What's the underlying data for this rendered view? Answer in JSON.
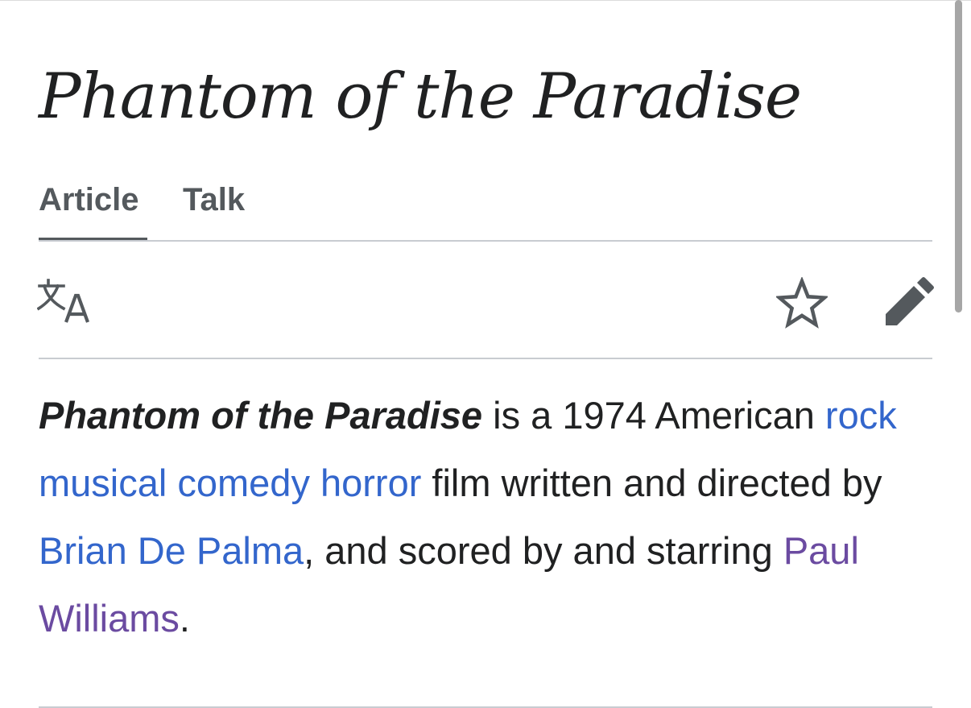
{
  "page": {
    "title": "Phantom of the Paradise"
  },
  "tabs": [
    {
      "label": "Article",
      "selected": true
    },
    {
      "label": "Talk",
      "selected": false
    }
  ],
  "toolbar": {
    "language_icon": "language-icon",
    "watch_icon": "star-icon",
    "edit_icon": "pencil-icon"
  },
  "lead": {
    "subject": "Phantom of the Paradise",
    "text_1": " is a 1974 American ",
    "link_genre": "rock musical comedy horror",
    "text_2": " film written and directed by ",
    "link_director": "Brian De Palma",
    "text_3": ", and scored by and starring ",
    "link_star": "Paul Williams",
    "text_4": "."
  },
  "colors": {
    "link": "#3366cc",
    "link_visited": "#6b4ba1",
    "text": "#202122",
    "tab_text": "#54595d",
    "divider": "#c8ccd1"
  }
}
